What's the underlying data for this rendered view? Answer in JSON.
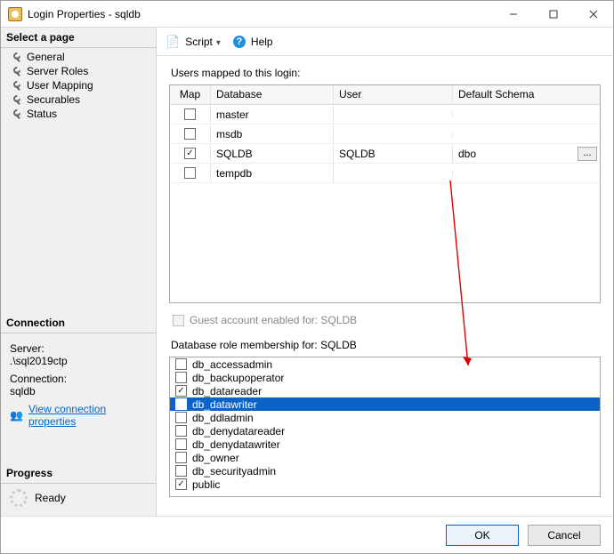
{
  "window": {
    "title": "Login Properties - sqldb"
  },
  "sidebar": {
    "select_page_header": "Select a page",
    "pages": [
      {
        "label": "General"
      },
      {
        "label": "Server Roles"
      },
      {
        "label": "User Mapping"
      },
      {
        "label": "Securables"
      },
      {
        "label": "Status"
      }
    ],
    "connection_header": "Connection",
    "server_label": "Server:",
    "server_value": ".\\sql2019ctp",
    "connection_label": "Connection:",
    "connection_value": "sqldb",
    "view_props_link": "View connection properties",
    "progress_header": "Progress",
    "progress_status": "Ready"
  },
  "toolbar": {
    "script_label": "Script",
    "help_label": "Help"
  },
  "mapping": {
    "section_label": "Users mapped to this login:",
    "columns": {
      "map": "Map",
      "database": "Database",
      "user": "User",
      "schema": "Default Schema"
    },
    "rows": [
      {
        "checked": false,
        "database": "master",
        "user": "",
        "schema": ""
      },
      {
        "checked": false,
        "database": "msdb",
        "user": "",
        "schema": ""
      },
      {
        "checked": true,
        "database": "SQLDB",
        "user": "SQLDB",
        "schema": "dbo",
        "show_ellipsis": true
      },
      {
        "checked": false,
        "database": "tempdb",
        "user": "",
        "schema": ""
      }
    ],
    "guest_label": "Guest account enabled for: SQLDB"
  },
  "roles": {
    "section_label": "Database role membership for: SQLDB",
    "items": [
      {
        "label": "db_accessadmin",
        "checked": false,
        "selected": false
      },
      {
        "label": "db_backupoperator",
        "checked": false,
        "selected": false
      },
      {
        "label": "db_datareader",
        "checked": true,
        "selected": false
      },
      {
        "label": "db_datawriter",
        "checked": true,
        "selected": true
      },
      {
        "label": "db_ddladmin",
        "checked": false,
        "selected": false
      },
      {
        "label": "db_denydatareader",
        "checked": false,
        "selected": false
      },
      {
        "label": "db_denydatawriter",
        "checked": false,
        "selected": false
      },
      {
        "label": "db_owner",
        "checked": false,
        "selected": false
      },
      {
        "label": "db_securityadmin",
        "checked": false,
        "selected": false
      },
      {
        "label": "public",
        "checked": true,
        "selected": false
      }
    ]
  },
  "footer": {
    "ok": "OK",
    "cancel": "Cancel"
  }
}
